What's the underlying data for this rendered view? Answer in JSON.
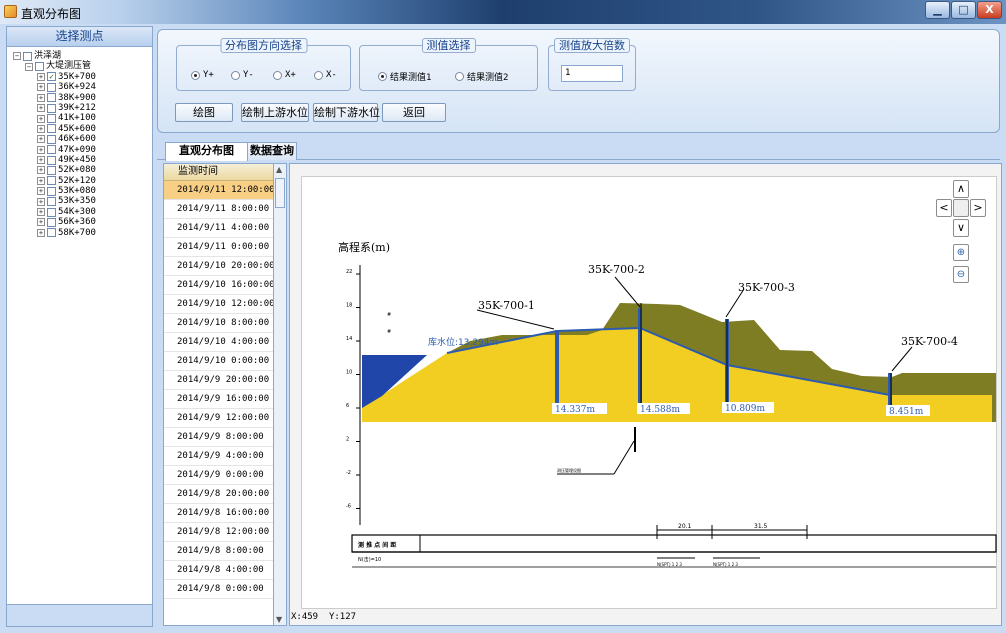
{
  "window": {
    "title": "直观分布图"
  },
  "tree": {
    "header": "选择测点",
    "root": "洪泽湖",
    "group": "大堤测压管",
    "items": [
      {
        "label": "35K+700",
        "checked": true
      },
      {
        "label": "36K+924",
        "checked": false
      },
      {
        "label": "38K+900",
        "checked": false
      },
      {
        "label": "39K+212",
        "checked": false
      },
      {
        "label": "41K+100",
        "checked": false
      },
      {
        "label": "45K+600",
        "checked": false
      },
      {
        "label": "46K+600",
        "checked": false
      },
      {
        "label": "47K+090",
        "checked": false
      },
      {
        "label": "49K+450",
        "checked": false
      },
      {
        "label": "52K+080",
        "checked": false
      },
      {
        "label": "52K+120",
        "checked": false
      },
      {
        "label": "53K+080",
        "checked": false
      },
      {
        "label": "53K+350",
        "checked": false
      },
      {
        "label": "54K+300",
        "checked": false
      },
      {
        "label": "56K+360",
        "checked": false
      },
      {
        "label": "58K+700",
        "checked": false
      }
    ]
  },
  "controls": {
    "direction_group": {
      "title": "分布图方向选择",
      "options": [
        "Y+",
        "Y-",
        "X+",
        "X-"
      ],
      "selected": "Y+"
    },
    "value_group": {
      "title": "测值选择",
      "options": [
        "结果测值1",
        "结果测值2"
      ],
      "selected": "结果测值1"
    },
    "scale_group": {
      "title": "测值放大倍数",
      "value": "1"
    },
    "buttons": {
      "draw": "绘图",
      "upstream": "绘制上游水位",
      "downstream": "绘制下游水位",
      "back": "返回"
    }
  },
  "tabs": [
    {
      "label": "直观分布图",
      "active": true
    },
    {
      "label": "数据查询",
      "active": false
    }
  ],
  "timelist": {
    "header": "监测时间",
    "rows": [
      "2014/9/11 12:00:00",
      "2014/9/11 8:00:00",
      "2014/9/11 4:00:00",
      "2014/9/11 0:00:00",
      "2014/9/10 20:00:00",
      "2014/9/10 16:00:00",
      "2014/9/10 12:00:00",
      "2014/9/10 8:00:00",
      "2014/9/10 4:00:00",
      "2014/9/10 0:00:00",
      "2014/9/9 20:00:00",
      "2014/9/9 16:00:00",
      "2014/9/9 12:00:00",
      "2014/9/9 8:00:00",
      "2014/9/9 4:00:00",
      "2014/9/9 0:00:00",
      "2014/9/8 20:00:00",
      "2014/9/8 16:00:00",
      "2014/9/8 12:00:00",
      "2014/9/8 8:00:00",
      "2014/9/8 4:00:00",
      "2014/9/8 0:00:00"
    ],
    "selected_index": 0
  },
  "drawing": {
    "ylabel": "高程系(m)",
    "yticks": [
      "22",
      "18",
      "14",
      "10",
      "6",
      "2",
      "-2",
      "-6"
    ],
    "reservoir_label": "库水位:13.294m",
    "points": [
      {
        "name": "35K-700-1",
        "value": "14.337m"
      },
      {
        "name": "35K-700-2",
        "value": "14.588m"
      },
      {
        "name": "35K-700-3",
        "value": "10.809m"
      },
      {
        "name": "35K-700-4",
        "value": "8.451m"
      }
    ],
    "table_title": "测 推 点 间 距",
    "table_row": "N(击)=10",
    "dims": [
      "20.1",
      "31.5"
    ],
    "spt_labels": [
      "N(SPT) 1 2 3",
      "N(SPT) 1 2 3"
    ],
    "annotation": "测压管埋设图",
    "colors": {
      "water": "#1f46a8",
      "sand": "#f2cd22",
      "soil": "#7e7d24",
      "line": "#2c5bb0"
    }
  },
  "coords": {
    "x_label": "X:459",
    "y_label": "Y:127"
  },
  "nav": {
    "up": "∧",
    "left": "<",
    "right": ">",
    "down": "∨"
  }
}
